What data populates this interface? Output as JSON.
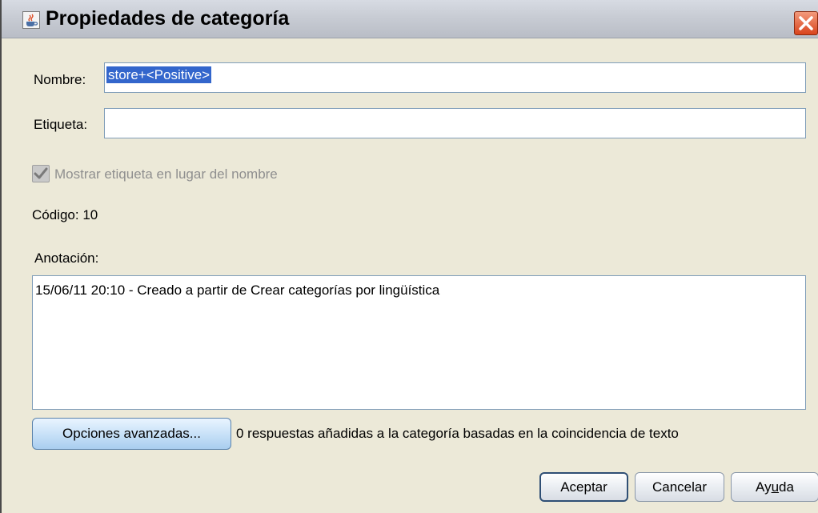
{
  "window": {
    "title": "Propiedades de categoría",
    "icon": "java-coffee-icon",
    "close_icon": "close-icon"
  },
  "form": {
    "name_label": "Nombre:",
    "name_value": "store+<Positive>",
    "tag_label": "Etiqueta:",
    "tag_value": "",
    "show_tag_label": "Mostrar etiqueta en lugar del nombre",
    "show_tag_checked": true,
    "code_text": "Código: 10",
    "annotation_label": "Anotación:",
    "annotation_value": "15/06/11 20:10 - Creado a partir de Crear categorías por lingüística"
  },
  "advanced": {
    "button_label": "Opciones avanzadas...",
    "status_text": "0 respuestas añadidas a la categoría basadas en la coincidencia de texto"
  },
  "buttons": {
    "ok": "Aceptar",
    "cancel": "Cancelar",
    "help_prefix": "Ay",
    "help_mnemonic": "u",
    "help_suffix": "da"
  },
  "colors": {
    "selection": "#3366cc",
    "dialog_bg": "#ece9d8",
    "close_button": "#d9441c"
  }
}
